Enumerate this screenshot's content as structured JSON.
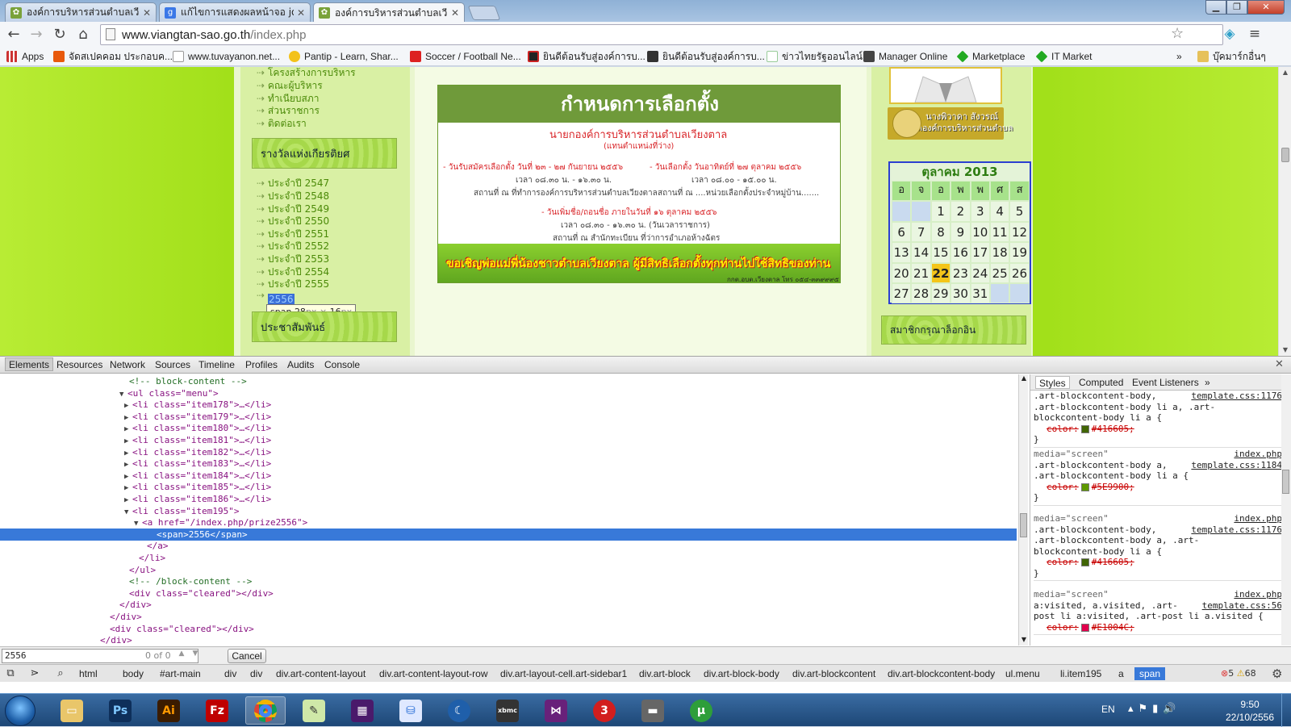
{
  "browser": {
    "tabs": [
      {
        "label": "องค์การบริหารส่วนตำบลเวียงตาล"
      },
      {
        "label": "แก้ไขการแสดงผลหน้าจอ joomla"
      },
      {
        "label": "องค์การบริหารส่วนตำบลเวียงตาล"
      }
    ],
    "url_host": "www.viangtan-sao.go.th",
    "url_path": "/index.php",
    "bookmarks": [
      {
        "label": "Apps"
      },
      {
        "label": "จัดสเปคคอม ประกอบค..."
      },
      {
        "label": "www.tuvayanon.net..."
      },
      {
        "label": "Pantip - Learn, Shar..."
      },
      {
        "label": "Soccer / Football Ne..."
      },
      {
        "label": "ยินดีต้อนรับสู่องค์การบ..."
      },
      {
        "label": "ยินดีต้อนรับสู่องค์การบ..."
      },
      {
        "label": "ข่าวไทยรัฐออนไลน์"
      },
      {
        "label": "Manager Online"
      },
      {
        "label": "Marketplace"
      },
      {
        "label": "IT Market"
      }
    ],
    "bookmarks_more": "»",
    "other_bookmarks": "บุ๊คมาร์กอื่นๆ"
  },
  "webpage": {
    "top_menu": [
      {
        "label": "โครงสร้างการบริหาร"
      },
      {
        "label": "คณะผู้บริหาร"
      },
      {
        "label": "ทำเนียบสภา"
      },
      {
        "label": "ส่วนราชการ"
      },
      {
        "label": "ติดต่อเรา"
      }
    ],
    "awards_header": "รางวัลแห่งเกียรติยศ",
    "award_years": [
      {
        "label": "ประจำปี 2547"
      },
      {
        "label": "ประจำปี 2548"
      },
      {
        "label": "ประจำปี 2549"
      },
      {
        "label": "ประจำปี 2550"
      },
      {
        "label": "ประจำปี 2551"
      },
      {
        "label": "ประจำปี 2552"
      },
      {
        "label": "ประจำปี 2553"
      },
      {
        "label": "ประจำปี 2554"
      },
      {
        "label": "ประจำปี 2555"
      }
    ],
    "highlighted_item": "2556",
    "tooltip": {
      "tag": "span",
      "w": "28",
      "h": "16",
      "unit": "px",
      "times": "×"
    },
    "pr_header": "ประชาสัมพันธ์",
    "banner": {
      "title": "กำหนดการเลือกตั้ง",
      "subtitle": "นายกองค์การบริหารส่วนตำบลเวียงตาล",
      "subtitle2": "(แทนตำแหน่งที่ว่าง)",
      "left1": "- วันรับสมัครเลือกตั้ง วันที่ ๒๓ - ๒๗ กันยายน ๒๕๕๖",
      "left2": "เวลา ๐๘.๓๐ น. - ๑๖.๓๐ น.",
      "left3": "สถานที่ ณ ที่ทำการองค์การบริหารส่วนตำบลเวียงตาล",
      "right1": "- วันเลือกตั้ง วันอาทิตย์ที่ ๒๗ ตุลาคม ๒๕๕๖",
      "right2": "เวลา ๐๘.๐๐ - ๑๕.๐๐ น.",
      "right3": "สถานที่ ณ ....หน่วยเลือกตั้งประจำหมู่บ้าน.......",
      "mid1": "- วันเพิ่มชื่อ/ถอนชื่อ ภายในวันที่ ๑๖ ตุลาคม ๒๕๕๖",
      "mid2": "เวลา ๐๘.๓๐ - ๑๖.๓๐ น. (วันเวลาราชการ)",
      "mid3": "สถานที่ ณ สำนักทะเบียน ที่ว่าการอำเภอห้างฉัตร",
      "cta": "ขอเชิญพ่อแม่พี่น้องชาวตำบลเวียงตาล ผู้มีสิทธิเลือกตั้งทุกท่านไปใช้สิทธิของท่าน",
      "footer": "กกต.อบต.เวียงตาล โทร ๐๕๔-๓๓๙๙๙๕"
    },
    "official": {
      "name": "นางพิวาดา สังวรณ์",
      "title": "รองปลัดองค์การบริหารส่วนตำบล"
    },
    "calendar": {
      "title": "ตุลาคม 2013",
      "weekdays": [
        "อ",
        "จ",
        "อ",
        "พ",
        "พ",
        "ศ",
        "ส"
      ],
      "rows": [
        [
          "",
          "",
          "1",
          "2",
          "3",
          "4",
          "5"
        ],
        [
          "6",
          "7",
          "8",
          "9",
          "10",
          "11",
          "12"
        ],
        [
          "13",
          "14",
          "15",
          "16",
          "17",
          "18",
          "19"
        ],
        [
          "20",
          "21",
          "22",
          "23",
          "24",
          "25",
          "26"
        ],
        [
          "27",
          "28",
          "29",
          "30",
          "31",
          "",
          ""
        ]
      ],
      "today": "22"
    },
    "member_header": "สมาชิกกรุณาล็อกอิน"
  },
  "devtools": {
    "tabs": [
      {
        "label": "Elements"
      },
      {
        "label": "Resources"
      },
      {
        "label": "Network"
      },
      {
        "label": "Sources"
      },
      {
        "label": "Timeline"
      },
      {
        "label": "Profiles"
      },
      {
        "label": "Audits"
      },
      {
        "label": "Console"
      }
    ],
    "dom_lines": [
      {
        "text": "<!-- block-content -->"
      },
      {
        "text": "<ul class=\"menu\">"
      },
      {
        "text": "<li class=\"item178\">…</li>"
      },
      {
        "text": "<li class=\"item179\">…</li>"
      },
      {
        "text": "<li class=\"item180\">…</li>"
      },
      {
        "text": "<li class=\"item181\">…</li>"
      },
      {
        "text": "<li class=\"item182\">…</li>"
      },
      {
        "text": "<li class=\"item183\">…</li>"
      },
      {
        "text": "<li class=\"item184\">…</li>"
      },
      {
        "text": "<li class=\"item185\">…</li>"
      },
      {
        "text": "<li class=\"item186\">…</li>"
      },
      {
        "text": "<li class=\"item195\">"
      },
      {
        "text": "<a href=\"/index.php/prize2556\">"
      },
      {
        "text": "<span>2556</span>"
      },
      {
        "text": "</a>"
      },
      {
        "text": "</li>"
      },
      {
        "text": "</ul>"
      },
      {
        "text": "<!-- /block-content -->"
      },
      {
        "text": "<div class=\"cleared\"></div>"
      },
      {
        "text": "</div>"
      },
      {
        "text": "</div>"
      },
      {
        "text": "<div class=\"cleared\"></div>"
      },
      {
        "text": "</div>"
      }
    ],
    "styles_tabs": [
      {
        "label": "Styles"
      },
      {
        "label": "Computed"
      },
      {
        "label": "Event Listeners"
      }
    ],
    "styles_more": "»",
    "rules": [
      {
        "media": "",
        "source": "template.css:1176",
        "selector": ".art-blockcontent-body, .art-blockcontent-body li a {",
        "selector1": ".art-blockcontent-body,",
        "selector2": ".art-blockcontent-body li a, .art-",
        "selector3": "blockcontent-body li a {",
        "prop": "color:",
        "value": "#416605;",
        "color": "#416605"
      },
      {
        "media": "media=\"screen\"",
        "file": "index.php",
        "source": "template.css:1184",
        "selector1": ".art-blockcontent-body a,",
        "selector2": ".art-blockcontent-body li a {",
        "prop": "color:",
        "value": "#5E9900;",
        "color": "#5E9900"
      },
      {
        "media": "media=\"screen\"",
        "file": "index.php",
        "source": "template.css:1176",
        "selector1": ".art-blockcontent-body,",
        "selector2": ".art-blockcontent-body a, .art-",
        "selector3": "blockcontent-body li a {",
        "prop": "color:",
        "value": "#416605;",
        "color": "#416605"
      },
      {
        "media": "media=\"screen\"",
        "file": "index.php",
        "source": "template.css:56",
        "selector1": "a:visited, a.visited, .art-",
        "selector2": "post li a:visited, .art-post li a.visited {",
        "prop": "color:",
        "value": "#E1004C;",
        "color": "#E1004C"
      }
    ],
    "rule_close": "}",
    "search": {
      "value": "2556",
      "count": "0 of 0",
      "cancel": "Cancel"
    },
    "breadcrumbs": [
      {
        "label": "html"
      },
      {
        "label": "body"
      },
      {
        "label": "#art-main"
      },
      {
        "label": "div"
      },
      {
        "label": "div"
      },
      {
        "label": "div.art-content-layout"
      },
      {
        "label": "div.art-content-layout-row"
      },
      {
        "label": "div.art-layout-cell.art-sidebar1"
      },
      {
        "label": "div.art-block"
      },
      {
        "label": "div.art-block-body"
      },
      {
        "label": "div.art-blockcontent"
      },
      {
        "label": "div.art-blockcontent-body"
      },
      {
        "label": "ul.menu"
      },
      {
        "label": "li.item195"
      },
      {
        "label": "a"
      },
      {
        "label": "span"
      }
    ],
    "errors": "5",
    "warnings": "68"
  },
  "taskbar": {
    "lang": "EN",
    "time": "9:50",
    "date": "22/10/2556"
  }
}
